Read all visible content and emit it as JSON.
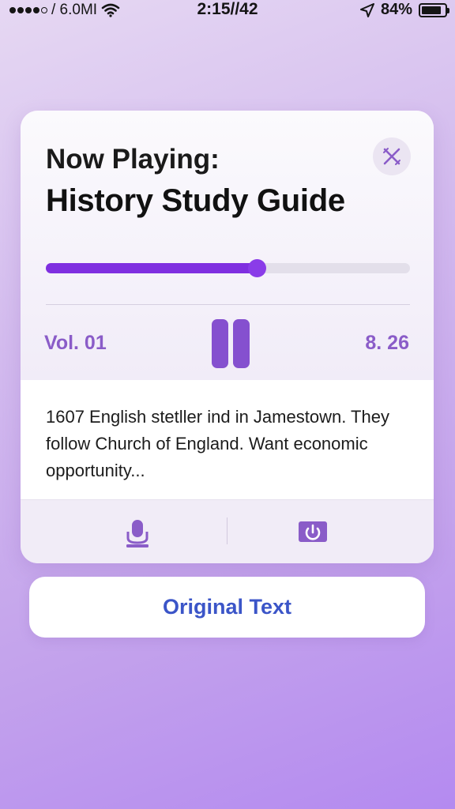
{
  "status_bar": {
    "carrier": "/ 6.0MI",
    "time": "2:15//42",
    "battery": "84%",
    "battery_level": 0.84,
    "icons": [
      "signal-dots-icon",
      "wifi-icon",
      "location-arrow-icon",
      "battery-icon"
    ]
  },
  "player": {
    "label": "Now Playing:",
    "title": "History Study Guide",
    "progress": 0.58,
    "volume": "Vol. 01",
    "time": "8. 26",
    "transcript": "1607 English stetller ind in Jamestown. They follow Church of England. Want economic opportunity...",
    "icons": {
      "close": "close-icon",
      "play_state": "pause-icon",
      "left_action": "microphone-icon",
      "right_action": "power-icon"
    }
  },
  "original_text_button": "Original Text",
  "colors": {
    "accent": "#7f2fe0",
    "accent_soft": "#8a5cc8",
    "link_blue": "#3b55c8",
    "background_start": "#e6d8f3",
    "background_end": "#b48af0"
  }
}
